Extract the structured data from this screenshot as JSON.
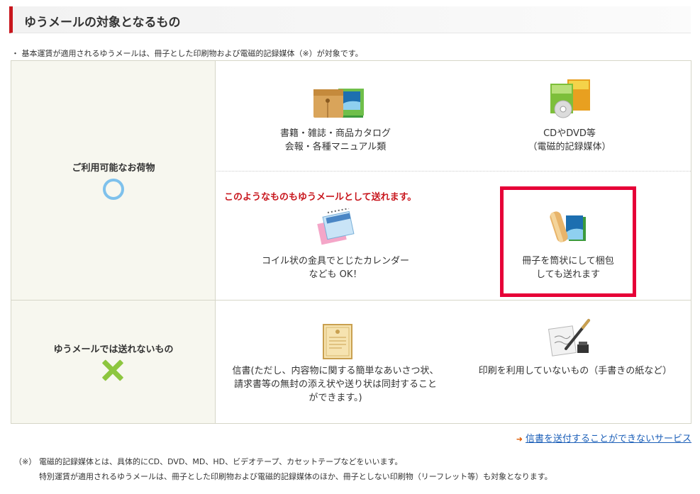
{
  "heading": {
    "title": "ゆうメールの対象となるもの"
  },
  "intro_note": "・ 基本運賃が適用されるゆうメールは、冊子とした印刷物および電磁的記録媒体（※）が対象です。",
  "rows": {
    "allowed": {
      "label": "ご利用可能なお荷物",
      "items": {
        "books": {
          "line1": "書籍・雑誌・商品カタログ",
          "line2": "会報・各種マニュアル類"
        },
        "media": {
          "line1": "CDやDVD等",
          "line2": "（電磁的記録媒体）"
        },
        "also_note": "このようなものもゆうメールとして送れます。",
        "calendar": {
          "line1": "コイル状の金具でとじたカレンダー",
          "line2": "なども OK！"
        },
        "rolled": {
          "line1": "冊子を筒状にして梱包",
          "line2": "しても送れます"
        }
      }
    },
    "not_allowed": {
      "label": "ゆうメールでは送れないもの",
      "items": {
        "letter": {
          "line1": "信書(ただし、内容物に関する簡単なあいさつ状、",
          "line2": "請求書等の無封の添え状や送り状は同封すること",
          "line3": "ができます。)"
        },
        "handwritten": {
          "line1": "印刷を利用していないもの（手書きの紙など）"
        }
      }
    }
  },
  "link": {
    "label": "信書を送付することができないサービス"
  },
  "footnotes": {
    "mark": "（※）",
    "line1": "電磁的記録媒体とは、具体的にCD、DVD、MD、HD、ビデオテープ、カセットテープなどをいいます。",
    "line2": "特別運賃が適用されるゆうメールは、冊子とした印刷物および電磁的記録媒体のほか、冊子としない印刷物（リーフレット等）も対象となります。"
  },
  "icons": {
    "books": "envelope-and-books-icon",
    "media": "cd-dvd-icon",
    "calendar": "spiral-calendar-icon",
    "rolled": "rolled-booklet-icon",
    "letter": "certificate-letter-icon",
    "handwritten": "pen-and-paper-icon",
    "ok": "circle-ok-icon",
    "ng": "cross-ng-icon"
  },
  "colors": {
    "accent_red": "#c8161d",
    "highlight": "#e60037",
    "ok_blue": "#7ec1ec",
    "ng_green": "#8dc63f",
    "link_blue": "#1a5eb8"
  }
}
